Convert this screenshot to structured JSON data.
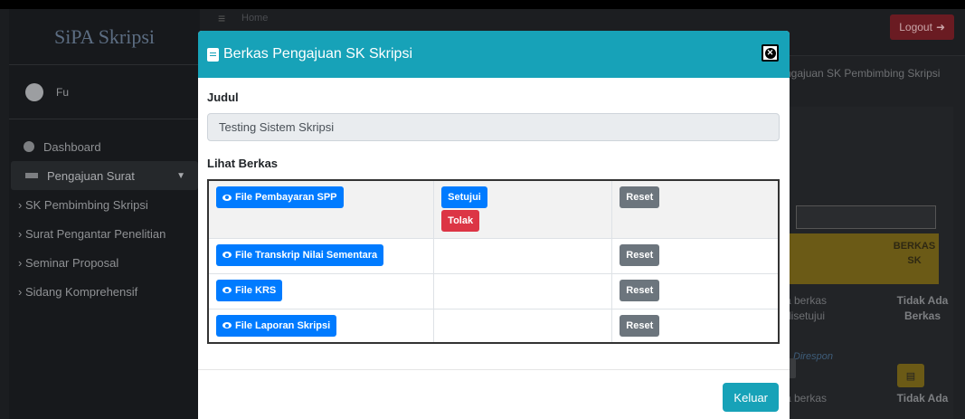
{
  "app": {
    "brand": "SiPA Skripsi",
    "user_name": "Fu",
    "header_link": "Home",
    "logout_label": "Logout"
  },
  "sidebar": {
    "items": [
      {
        "label": "Dashboard"
      },
      {
        "label": "Pengajuan Surat"
      }
    ],
    "sub_items": [
      {
        "label": "SK Pembimbing Skripsi"
      },
      {
        "label": "Surat Pengantar Penelitian"
      },
      {
        "label": "Seminar Proposal"
      },
      {
        "label": "Sidang Komprehensif"
      }
    ]
  },
  "background": {
    "breadcrumb": "ngajuan SK Pembimbing Skripsi",
    "column_berkas": "BERKAS SK",
    "row1_status": "a berkas disetujui",
    "row1_sk": "Tidak Ada Berkas",
    "row2_status": "Direspon",
    "row3_status": "a berkas",
    "row3_sk": "Tidak Ada"
  },
  "modal": {
    "title": "Berkas Pengajuan SK Skripsi",
    "judul_label": "Judul",
    "judul_value": "Testing Sistem Skripsi",
    "berkas_label": "Lihat Berkas",
    "files": [
      {
        "label": "File Pembayaran SPP",
        "approve": "Setujui",
        "reject": "Tolak",
        "reset": "Reset"
      },
      {
        "label": "File Transkrip Nilai Sementara",
        "reset": "Reset"
      },
      {
        "label": "File KRS",
        "reset": "Reset"
      },
      {
        "label": "File Laporan Skripsi",
        "reset": "Reset"
      }
    ],
    "close_label": "Keluar"
  },
  "colors": {
    "accent": "#17a2b8",
    "primary": "#007bff",
    "danger": "#dc3545",
    "secondary": "#6c757d"
  }
}
